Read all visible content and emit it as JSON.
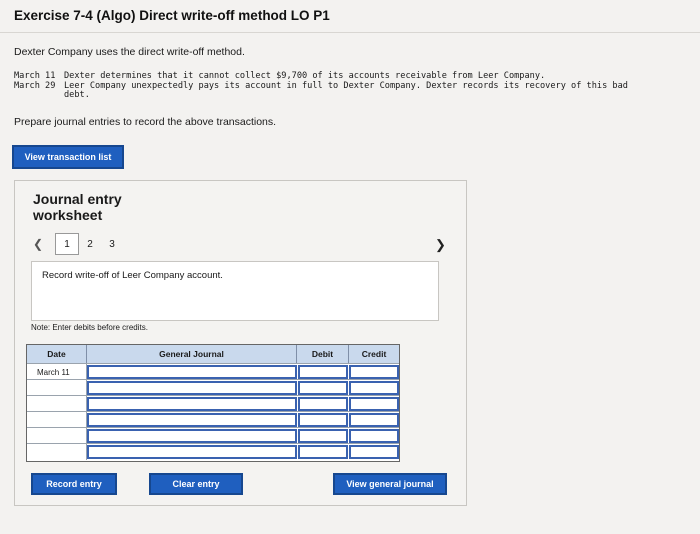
{
  "header": {
    "title": "Exercise 7-4 (Algo) Direct write-off method LO P1"
  },
  "intro": "Dexter Company uses the direct write-off method.",
  "events": [
    {
      "date": "March 11",
      "text": "Dexter determines that it cannot collect $9,700 of its accounts receivable from Leer Company."
    },
    {
      "date": "March 29",
      "text": "Leer Company unexpectedly pays its account in full to Dexter Company. Dexter records its recovery of this bad debt."
    }
  ],
  "prompt": "Prepare journal entries to record the above transactions.",
  "buttons": {
    "view_transaction_list": "View transaction list",
    "record_entry": "Record entry",
    "clear_entry": "Clear entry",
    "view_general_journal": "View general journal"
  },
  "worksheet": {
    "title": "Journal entry worksheet",
    "pages": [
      "1",
      "2",
      "3"
    ],
    "active_page": "1",
    "description": "Record write-off of Leer Company account.",
    "note": "Note: Enter debits before credits.",
    "columns": {
      "date": "Date",
      "general_journal": "General Journal",
      "debit": "Debit",
      "credit": "Credit"
    },
    "rows": [
      {
        "date": "March 11"
      },
      {
        "date": ""
      },
      {
        "date": ""
      },
      {
        "date": ""
      },
      {
        "date": ""
      },
      {
        "date": ""
      }
    ]
  },
  "colors": {
    "button_blue": "#1f5fbf",
    "header_blue": "#c9d9ed",
    "input_border": "#3a62b0"
  }
}
